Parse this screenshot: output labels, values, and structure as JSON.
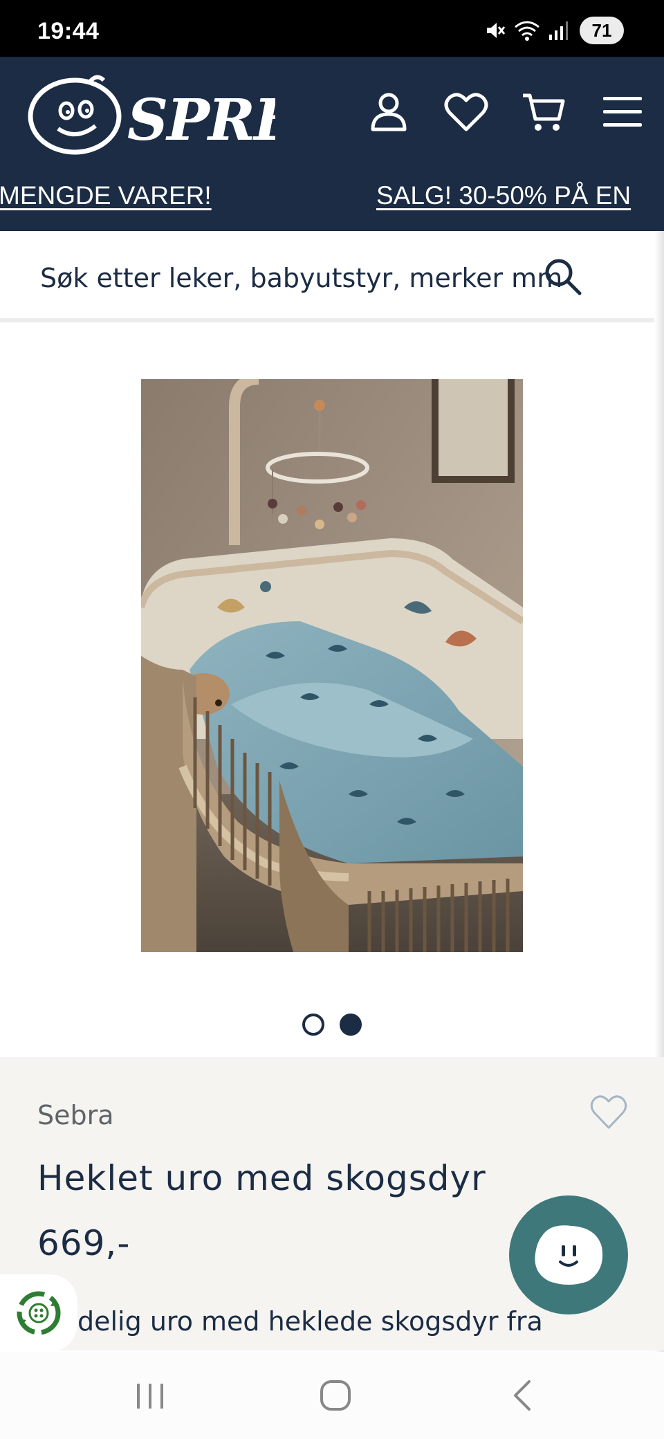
{
  "status_bar": {
    "time": "19:44",
    "battery": "71",
    "icons": [
      "mute-icon",
      "wifi-icon",
      "signal-icon",
      "battery-icon"
    ]
  },
  "header": {
    "logo_text": "SPRELL",
    "icons": [
      "account-icon",
      "heart-icon",
      "cart-icon",
      "menu-icon"
    ],
    "marquee": [
      "MENGDE VARER!",
      "SALG! 30-50% PÅ EN"
    ]
  },
  "search": {
    "placeholder": "Søk etter leker, babyutstyr, merker mm"
  },
  "carousel": {
    "slide_count": 2,
    "active_index": 1
  },
  "product": {
    "brand": "Sebra",
    "title": "Heklet uro med skogsdyr",
    "price": "669,-",
    "description_fragment": "delig uro med heklede skogsdyr fra"
  },
  "colors": {
    "navy": "#1b2c44",
    "teal": "#3f787a",
    "info_bg": "#f5f4f1",
    "eco_green": "#2e7d32"
  },
  "nav_bar": {
    "icons": [
      "recent-apps-icon",
      "home-icon",
      "back-icon"
    ]
  }
}
